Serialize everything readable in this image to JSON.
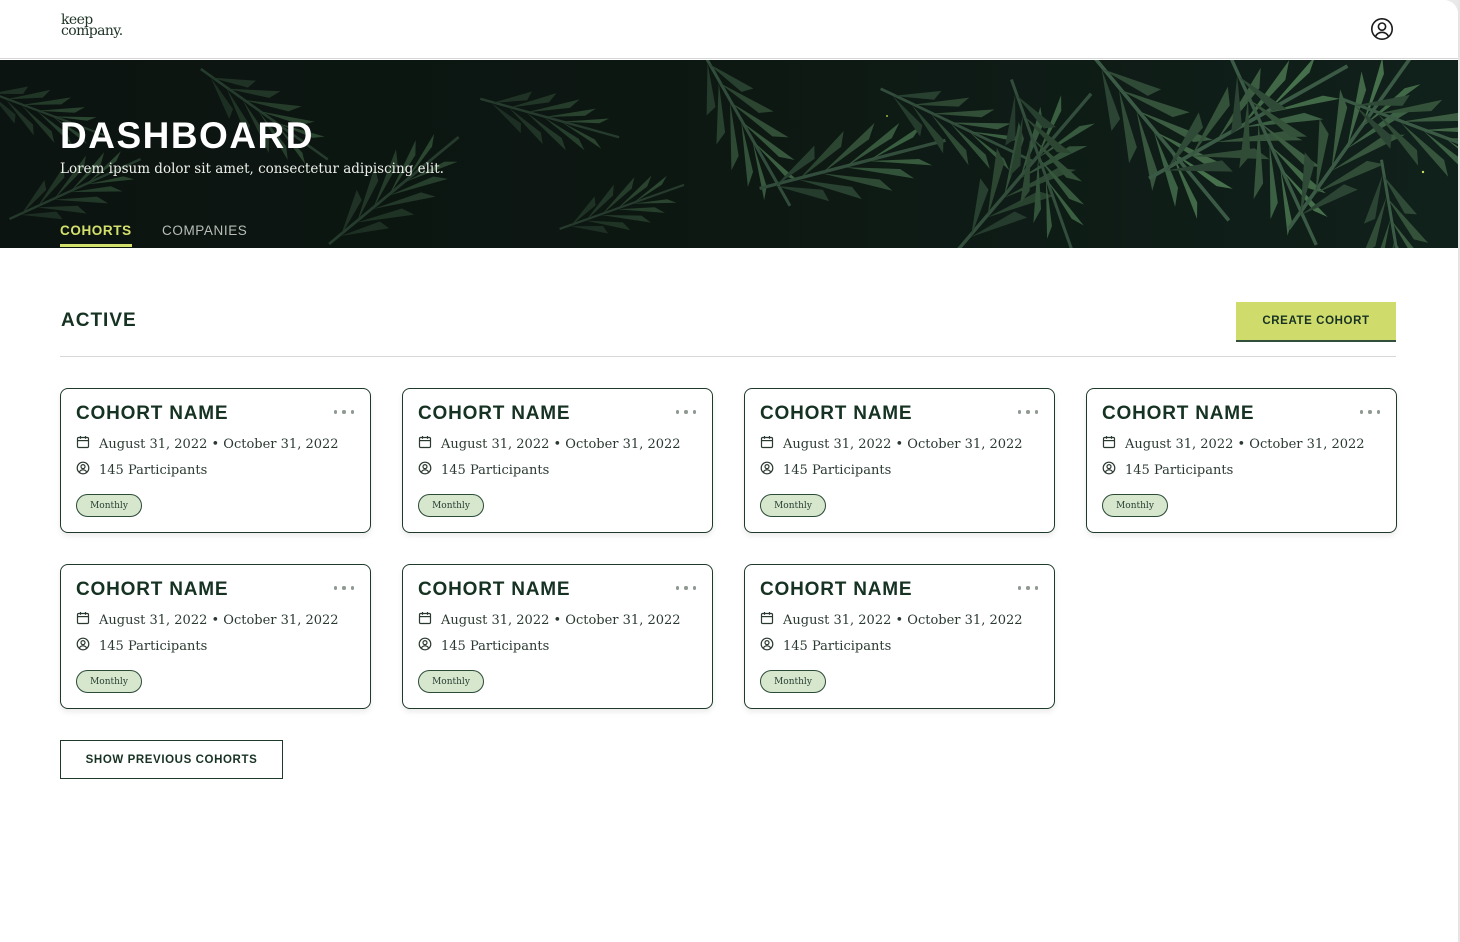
{
  "app": {
    "logo_line1": "keep",
    "logo_line2": "company."
  },
  "hero": {
    "title": "DASHBOARD",
    "subtitle": "Lorem ipsum dolor sit amet, consectetur adipiscing elit.",
    "tabs": [
      {
        "label": "COHORTS",
        "active": true
      },
      {
        "label": "COMPANIES",
        "active": false
      }
    ]
  },
  "section": {
    "title": "ACTIVE",
    "create_button": "CREATE COHORT",
    "show_previous_button": "SHOW PREVIOUS COHORTS"
  },
  "cohorts": [
    {
      "name": "COHORT NAME",
      "dates": "August 31, 2022 • October 31, 2022",
      "participants": "145 Participants",
      "frequency": "Monthly"
    },
    {
      "name": "COHORT NAME",
      "dates": "August 31, 2022 • October 31, 2022",
      "participants": "145 Participants",
      "frequency": "Monthly"
    },
    {
      "name": "COHORT NAME",
      "dates": "August 31, 2022 • October 31, 2022",
      "participants": "145 Participants",
      "frequency": "Monthly"
    },
    {
      "name": "COHORT NAME",
      "dates": "August 31, 2022 • October 31, 2022",
      "participants": "145 Participants",
      "frequency": "Monthly"
    },
    {
      "name": "COHORT NAME",
      "dates": "August 31, 2022 • October 31, 2022",
      "participants": "145 Participants",
      "frequency": "Monthly"
    },
    {
      "name": "COHORT NAME",
      "dates": "August 31, 2022 • October 31, 2022",
      "participants": "145 Participants",
      "frequency": "Monthly"
    },
    {
      "name": "COHORT NAME",
      "dates": "August 31, 2022 • October 31, 2022",
      "participants": "145 Participants",
      "frequency": "Monthly"
    }
  ],
  "colors": {
    "accent": "#cfdc6b",
    "tab_active": "#d4e06c",
    "brand_dark": "#163223",
    "pill_bg": "#d6e7ce"
  },
  "icons": {
    "user": "user-circle-icon",
    "calendar": "calendar-icon",
    "participants": "user-circle-icon",
    "more": "more-horizontal-icon"
  }
}
